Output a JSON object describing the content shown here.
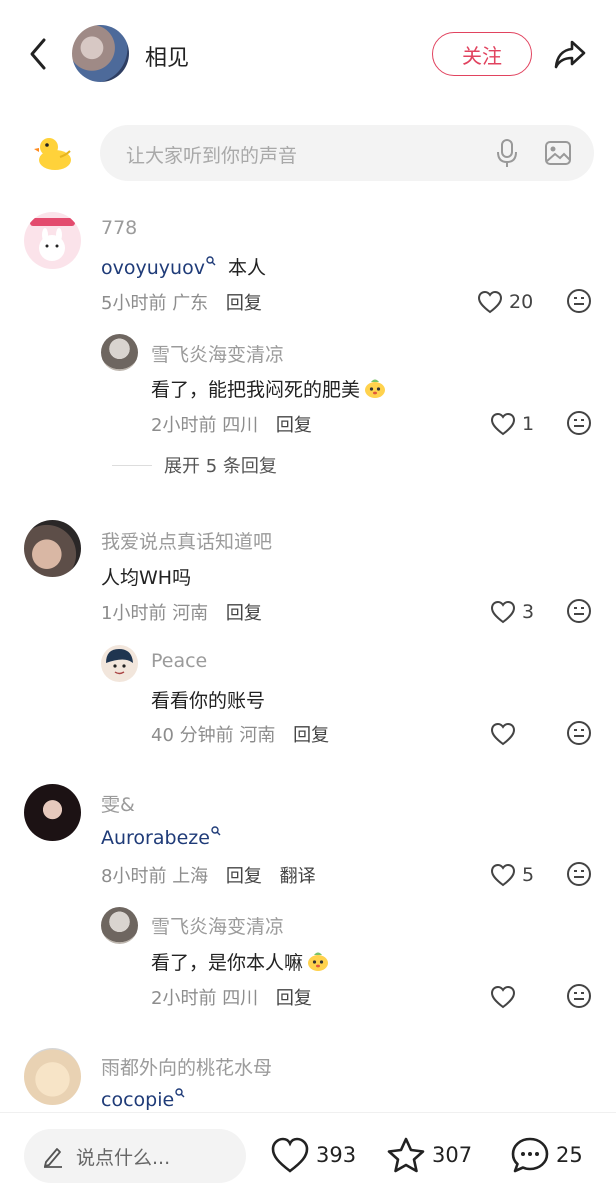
{
  "header": {
    "name": "相见",
    "follow_label": "关注"
  },
  "input": {
    "placeholder": "让大家听到你的声音"
  },
  "comments": [
    {
      "username": "778",
      "mention": "ovoyuyuov",
      "text": "本人",
      "time": "5小时前",
      "location": "广东",
      "reply_label": "回复",
      "likes": "20",
      "replies": [
        {
          "username": "雪飞炎海变清凉",
          "text": "看了，能把我闷死的肥美",
          "time": "2小时前",
          "location": "四川",
          "reply_label": "回复",
          "likes": "1"
        }
      ],
      "expand_label": "展开 5 条回复"
    },
    {
      "username": "我爱说点真话知道吧",
      "text": "人均WH吗",
      "time": "1小时前",
      "location": "河南",
      "reply_label": "回复",
      "likes": "3",
      "replies": [
        {
          "username": "Peace",
          "text": "看看你的账号",
          "time": "40 分钟前",
          "location": "河南",
          "reply_label": "回复",
          "likes": ""
        }
      ]
    },
    {
      "username": "雯&",
      "mention": "Aurorabeze",
      "text": "",
      "time": "8小时前",
      "location": "上海",
      "reply_label": "回复",
      "translate_label": "翻译",
      "likes": "5",
      "replies": [
        {
          "username": "雪飞炎海变清凉",
          "text": "看了，是你本人嘛",
          "time": "2小时前",
          "location": "四川",
          "reply_label": "回复",
          "likes": ""
        }
      ]
    },
    {
      "username": "雨都外向的桃花水母",
      "mention": "cocopie"
    }
  ],
  "bottom": {
    "say_placeholder": "说点什么...",
    "likes": "393",
    "stars": "307",
    "comments": "25"
  },
  "colors": {
    "accent": "#e1435f",
    "mention": "#1f3b78"
  },
  "icons": [
    "back-icon",
    "share-icon",
    "duck-icon",
    "microphone-icon",
    "image-icon",
    "heart-icon",
    "emoji-icon",
    "pencil-icon",
    "star-icon",
    "comment-icon",
    "search-mini-icon"
  ]
}
